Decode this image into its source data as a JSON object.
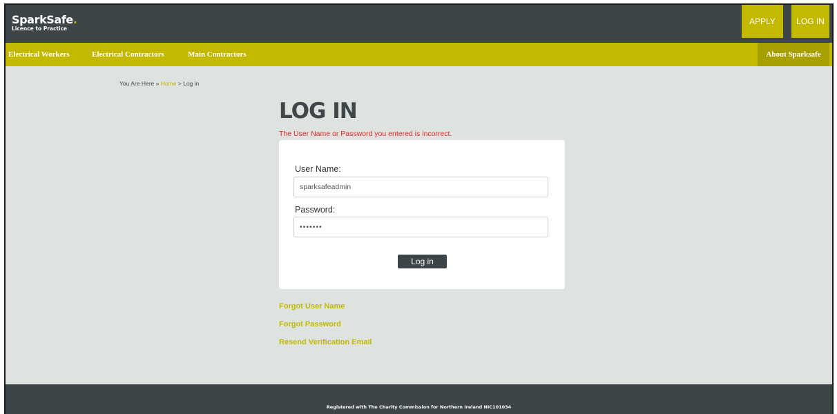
{
  "brand": {
    "name": "SparkSafe",
    "dot": ".",
    "tagline": "Licence to Practice"
  },
  "header_buttons": {
    "apply": "APPLY",
    "login": "LOG IN"
  },
  "nav": {
    "items": [
      "Electrical Workers",
      "Electrical Contractors",
      "Main Contractors"
    ],
    "about": "About Sparksafe"
  },
  "breadcrumb": {
    "prefix": "You Are Here »",
    "home": "Home",
    "current": "> Log in"
  },
  "page": {
    "title": "LOG IN",
    "error": "The User Name or Password you entered is incorrect."
  },
  "form": {
    "username_label": "User Name:",
    "username_value": "sparksafeadmin",
    "password_label": "Password:",
    "password_value": "•••••••",
    "submit_label": "Log in"
  },
  "links": {
    "forgot_user": "Forgot User Name",
    "forgot_password": "Forgot Password",
    "resend": "Resend Verification Email"
  },
  "footer": {
    "text": "Registered with The Charity Commission for Northern Ireland NIC101034"
  },
  "colors": {
    "accent": "#c2b900",
    "header": "#3d4549",
    "background": "#dfe3df",
    "error": "#e0262a"
  }
}
